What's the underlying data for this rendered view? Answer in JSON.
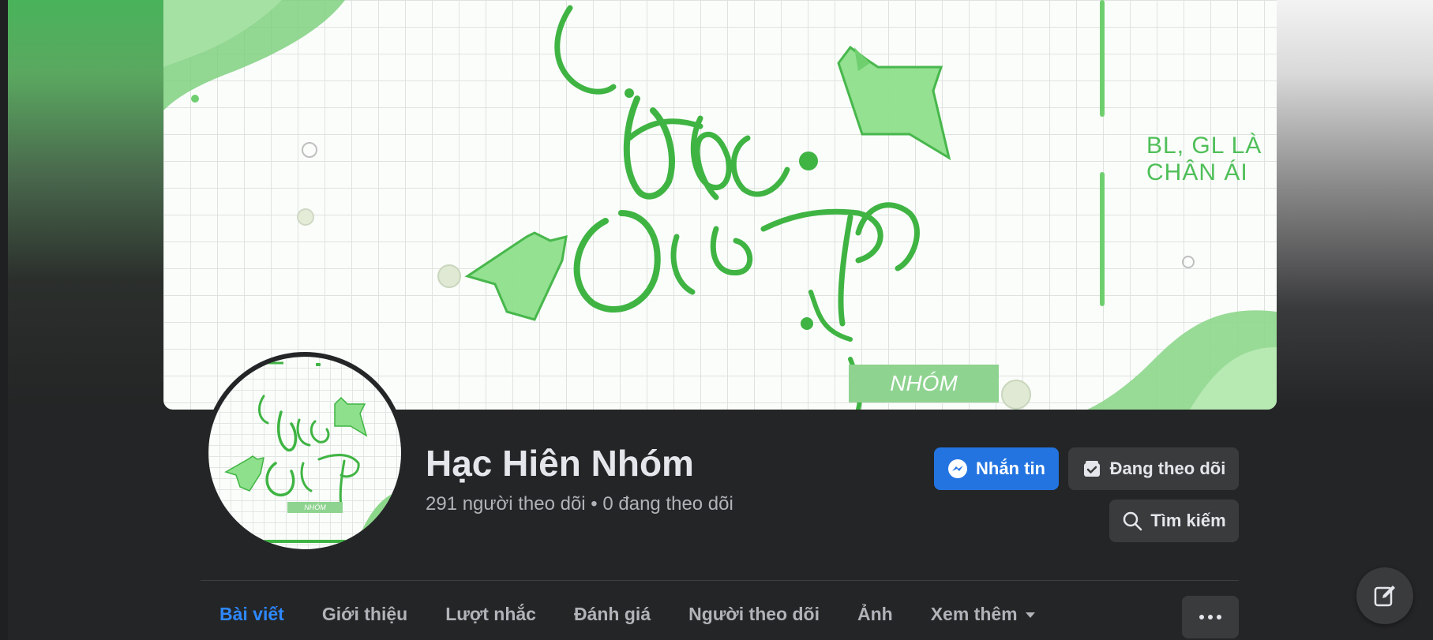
{
  "page": {
    "name": "Hạc Hiên Nhóm",
    "followers_text": "291 người theo dõi • 0 đang theo dõi"
  },
  "cover": {
    "tagline": "BL, GL LÀ CHÂN ÁI",
    "badge": "NHÓM"
  },
  "avatar": {
    "badge": "NHÓM"
  },
  "actions": {
    "message_label": "Nhắn tin",
    "following_label": "Đang theo dõi",
    "search_label": "Tìm kiếm"
  },
  "tabs": [
    {
      "label": "Bài viết",
      "active": true
    },
    {
      "label": "Giới thiệu",
      "active": false
    },
    {
      "label": "Lượt nhắc",
      "active": false
    },
    {
      "label": "Đánh giá",
      "active": false
    },
    {
      "label": "Người theo dõi",
      "active": false
    },
    {
      "label": "Ảnh",
      "active": false
    },
    {
      "label": "Xem thêm",
      "active": false
    }
  ],
  "icons": {
    "message": "messenger-icon",
    "following": "following-icon",
    "search": "search-icon",
    "more": "more-dots-icon",
    "compose": "compose-icon"
  },
  "colors": {
    "accent_blue": "#2374e1",
    "active_tab": "#2d88ff",
    "brand_green": "#4fbf58",
    "background": "#242526"
  }
}
